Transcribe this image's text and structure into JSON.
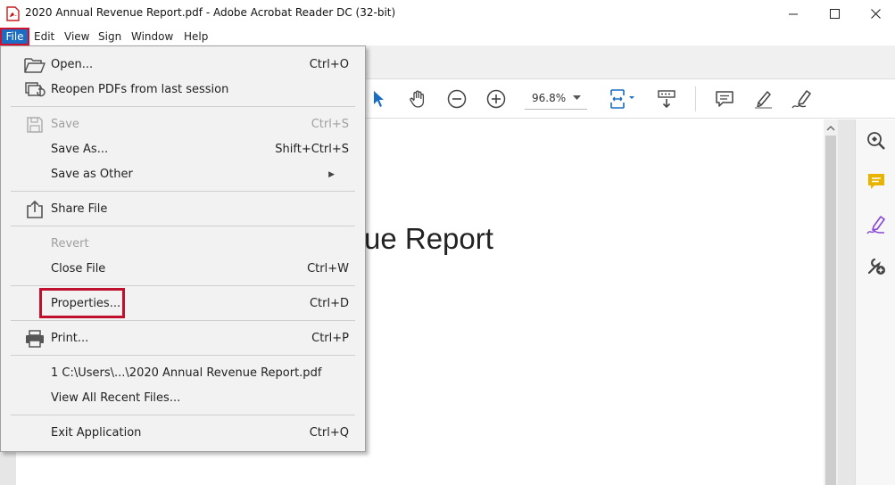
{
  "window": {
    "title": "2020 Annual Revenue Report.pdf - Adobe Acrobat Reader DC (32-bit)",
    "minimize_glyph": "—",
    "maximize_glyph": "☐",
    "close_glyph": "✕"
  },
  "menubar": {
    "file": "File",
    "edit": "Edit",
    "view": "View",
    "sign": "Sign",
    "window": "Window",
    "help": "Help"
  },
  "toolbar": {
    "zoom": "96.8%"
  },
  "document": {
    "visible_title_fragment": "ue Report"
  },
  "file_menu": {
    "open": {
      "label": "Open...",
      "shortcut": "Ctrl+O"
    },
    "reopen": {
      "label": "Reopen PDFs from last session"
    },
    "save": {
      "label": "Save",
      "shortcut": "Ctrl+S"
    },
    "save_as": {
      "label": "Save As...",
      "shortcut": "Shift+Ctrl+S"
    },
    "save_as_other": {
      "label": "Save as Other"
    },
    "share_file": {
      "label": "Share File"
    },
    "revert": {
      "label": "Revert"
    },
    "close_file": {
      "label": "Close File",
      "shortcut": "Ctrl+W"
    },
    "properties": {
      "label": "Properties...",
      "shortcut": "Ctrl+D"
    },
    "print": {
      "label": "Print...",
      "shortcut": "Ctrl+P"
    },
    "recent_1": {
      "label": "1 C:\\Users\\...\\2020 Annual Revenue Report.pdf"
    },
    "view_all_recent": {
      "label": "View All Recent Files..."
    },
    "exit": {
      "label": "Exit Application",
      "shortcut": "Ctrl+Q"
    }
  },
  "colors": {
    "accent": "#1a6dc2",
    "highlight": "#c0102e",
    "menu_bg": "#f2f2f2",
    "comment": "#e8b400",
    "sign": "#8a4bd6"
  }
}
